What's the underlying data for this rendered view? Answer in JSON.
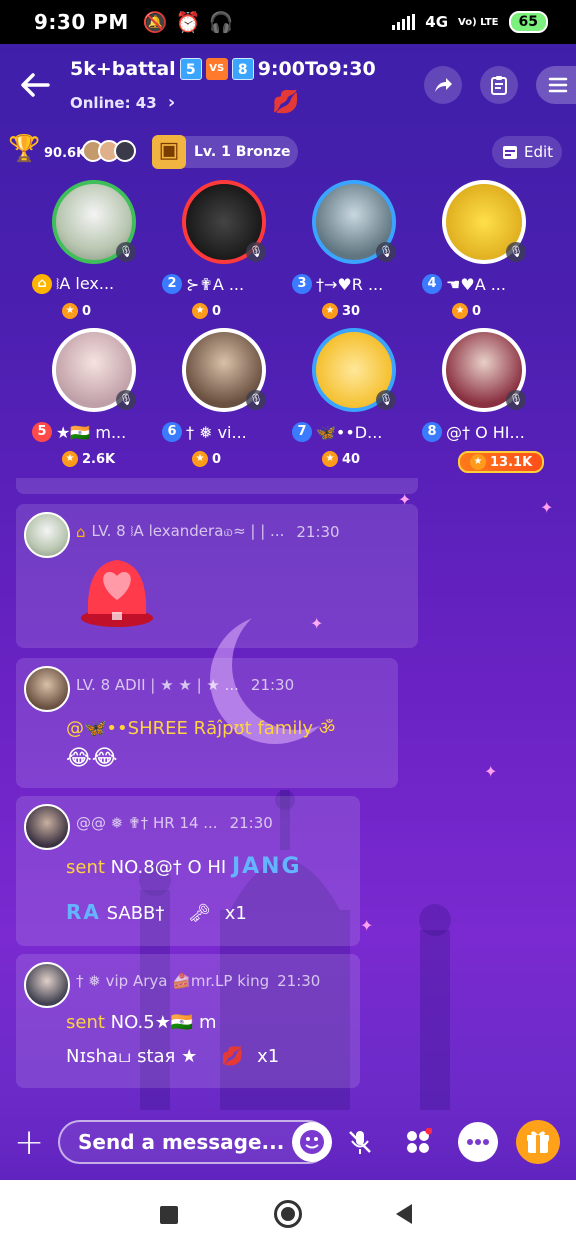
{
  "status_bar": {
    "time": "9:30 PM",
    "network": "4G",
    "volte": "Vo) LTE",
    "battery": "65"
  },
  "header": {
    "title": "5k+battal",
    "badge_left": "5",
    "vs": "VS",
    "badge_right": "8",
    "time_range": "9:00To9:30",
    "online_label": "Online: 43",
    "online_chevron": "›"
  },
  "info_row": {
    "trophy_count": "90.6K",
    "level_label": "Lv. 1 Bronze",
    "edit_label": "Edit"
  },
  "seats": [
    {
      "num": "1",
      "name": "⧘A lex...",
      "count": "0",
      "ring": "#3fbf5a"
    },
    {
      "num": "2",
      "name": "⊱✟A ...",
      "count": "0",
      "ring": "#ff3a3a"
    },
    {
      "num": "3",
      "name": "†→♥R ...",
      "count": "30",
      "ring": "#3aa4ff"
    },
    {
      "num": "4",
      "name": "☚♥A ...",
      "count": "0",
      "ring": "#ffffff"
    },
    {
      "num": "5",
      "name": "★🇮🇳 m...",
      "count": "2.6K",
      "ring": "#ffffff"
    },
    {
      "num": "6",
      "name": "† ❅ vi...",
      "count": "0",
      "ring": "#ffffff"
    },
    {
      "num": "7",
      "name": "🦋••D...",
      "count": "40",
      "ring": "#3aa4ff"
    },
    {
      "num": "8",
      "name": "@† O HI...",
      "count": "13.1K",
      "ring": "#ffffff"
    }
  ],
  "chats": [
    {
      "meta": "LV. 8 ⧘A lexandera௰≈ | | ...",
      "time": "21:30"
    },
    {
      "meta": "LV. 8 ADII | ★ ★ | ★ ...",
      "time": "21:30",
      "text": "@🦋••SHREE Rāĵpʊt family ॐ",
      "emoji": "😂😂"
    },
    {
      "meta": "@@ ❅ ✟† HR 14 ...",
      "time": "21:30",
      "sent": "sent",
      "text_a": "NO.8@† O HI",
      "text_b": "JANG",
      "text_c": "RA",
      "text_d": "SABB†",
      "mult": "x1"
    },
    {
      "meta": "† ❅ vip Arya 🍰mr.LP king",
      "time": "21:30",
      "sent": "sent",
      "text_a": "NO.5★🇮🇳 m",
      "text_b": "Nɪshaப staя ★",
      "mult": "x1"
    }
  ],
  "input": {
    "placeholder": "Send a message..."
  },
  "colors": {
    "accent": "#ffb23a",
    "bg_top": "#3d1fa8",
    "bg_bottom": "#6a22c4"
  }
}
